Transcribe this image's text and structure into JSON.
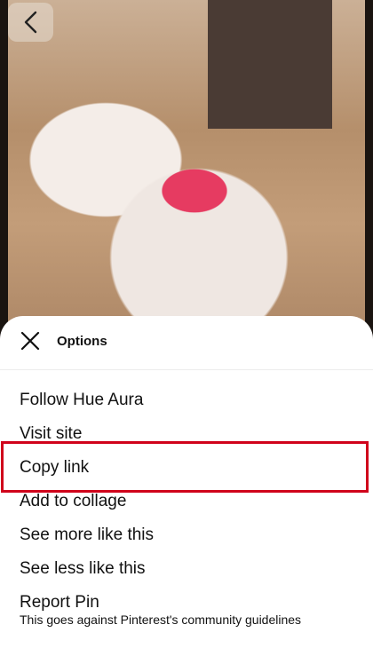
{
  "pin": {
    "image_alt": "White cat wearing a pink flower crown"
  },
  "sheet": {
    "title": "Options",
    "options": [
      {
        "label": "Follow Hue Aura"
      },
      {
        "label": "Visit site"
      },
      {
        "label": "Copy link"
      },
      {
        "label": "Add to collage"
      },
      {
        "label": "See more like this"
      },
      {
        "label": "See less like this"
      },
      {
        "label": "Report Pin",
        "sublabel": "This goes against Pinterest's community guidelines"
      }
    ]
  },
  "icons": {
    "back": "chevron-left-icon",
    "close": "close-icon"
  },
  "colors": {
    "highlight": "#d0021b",
    "sheet_background": "#ffffff",
    "text": "#111111"
  }
}
